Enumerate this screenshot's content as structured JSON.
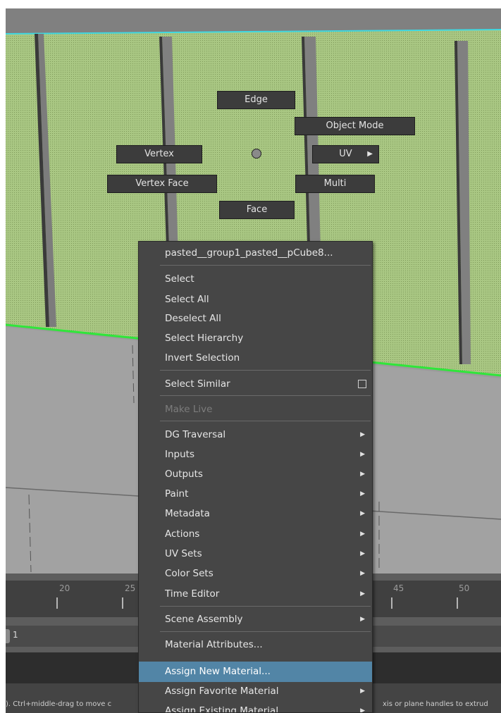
{
  "marking_menu": {
    "edge": "Edge",
    "object_mode": "Object Mode",
    "vertex": "Vertex",
    "uv": "UV",
    "vertex_face": "Vertex Face",
    "multi": "Multi",
    "face": "Face"
  },
  "context_menu": {
    "object_name": "pasted__group1_pasted__pCube8...",
    "items": [
      {
        "label": "Select"
      },
      {
        "label": "Select All"
      },
      {
        "label": "Deselect All"
      },
      {
        "label": "Select Hierarchy"
      },
      {
        "label": "Invert Selection"
      },
      {
        "label": "Select Similar"
      },
      {
        "label": "Make Live"
      },
      {
        "label": "DG Traversal"
      },
      {
        "label": "Inputs"
      },
      {
        "label": "Outputs"
      },
      {
        "label": "Paint"
      },
      {
        "label": "Metadata"
      },
      {
        "label": "Actions"
      },
      {
        "label": "UV Sets"
      },
      {
        "label": "Color Sets"
      },
      {
        "label": "Time Editor"
      },
      {
        "label": "Scene Assembly"
      },
      {
        "label": "Material Attributes..."
      },
      {
        "label": "Assign New Material..."
      },
      {
        "label": "Assign Favorite Material"
      },
      {
        "label": "Assign Existing Material"
      }
    ]
  },
  "timeline": {
    "ticks": [
      "20",
      "25",
      "45",
      "50"
    ]
  },
  "range_slider": {
    "start": "1"
  },
  "help_line": {
    "left": "). Ctrl+middle-drag to move c",
    "right": "xis or plane handles to extrud"
  },
  "colors": {
    "selection_highlight": "#5285a6",
    "menu_bg": "#464646",
    "selected_mesh": "#9ab870",
    "wire_green": "#2fe63a",
    "wire_cyan": "#40d8e0"
  }
}
